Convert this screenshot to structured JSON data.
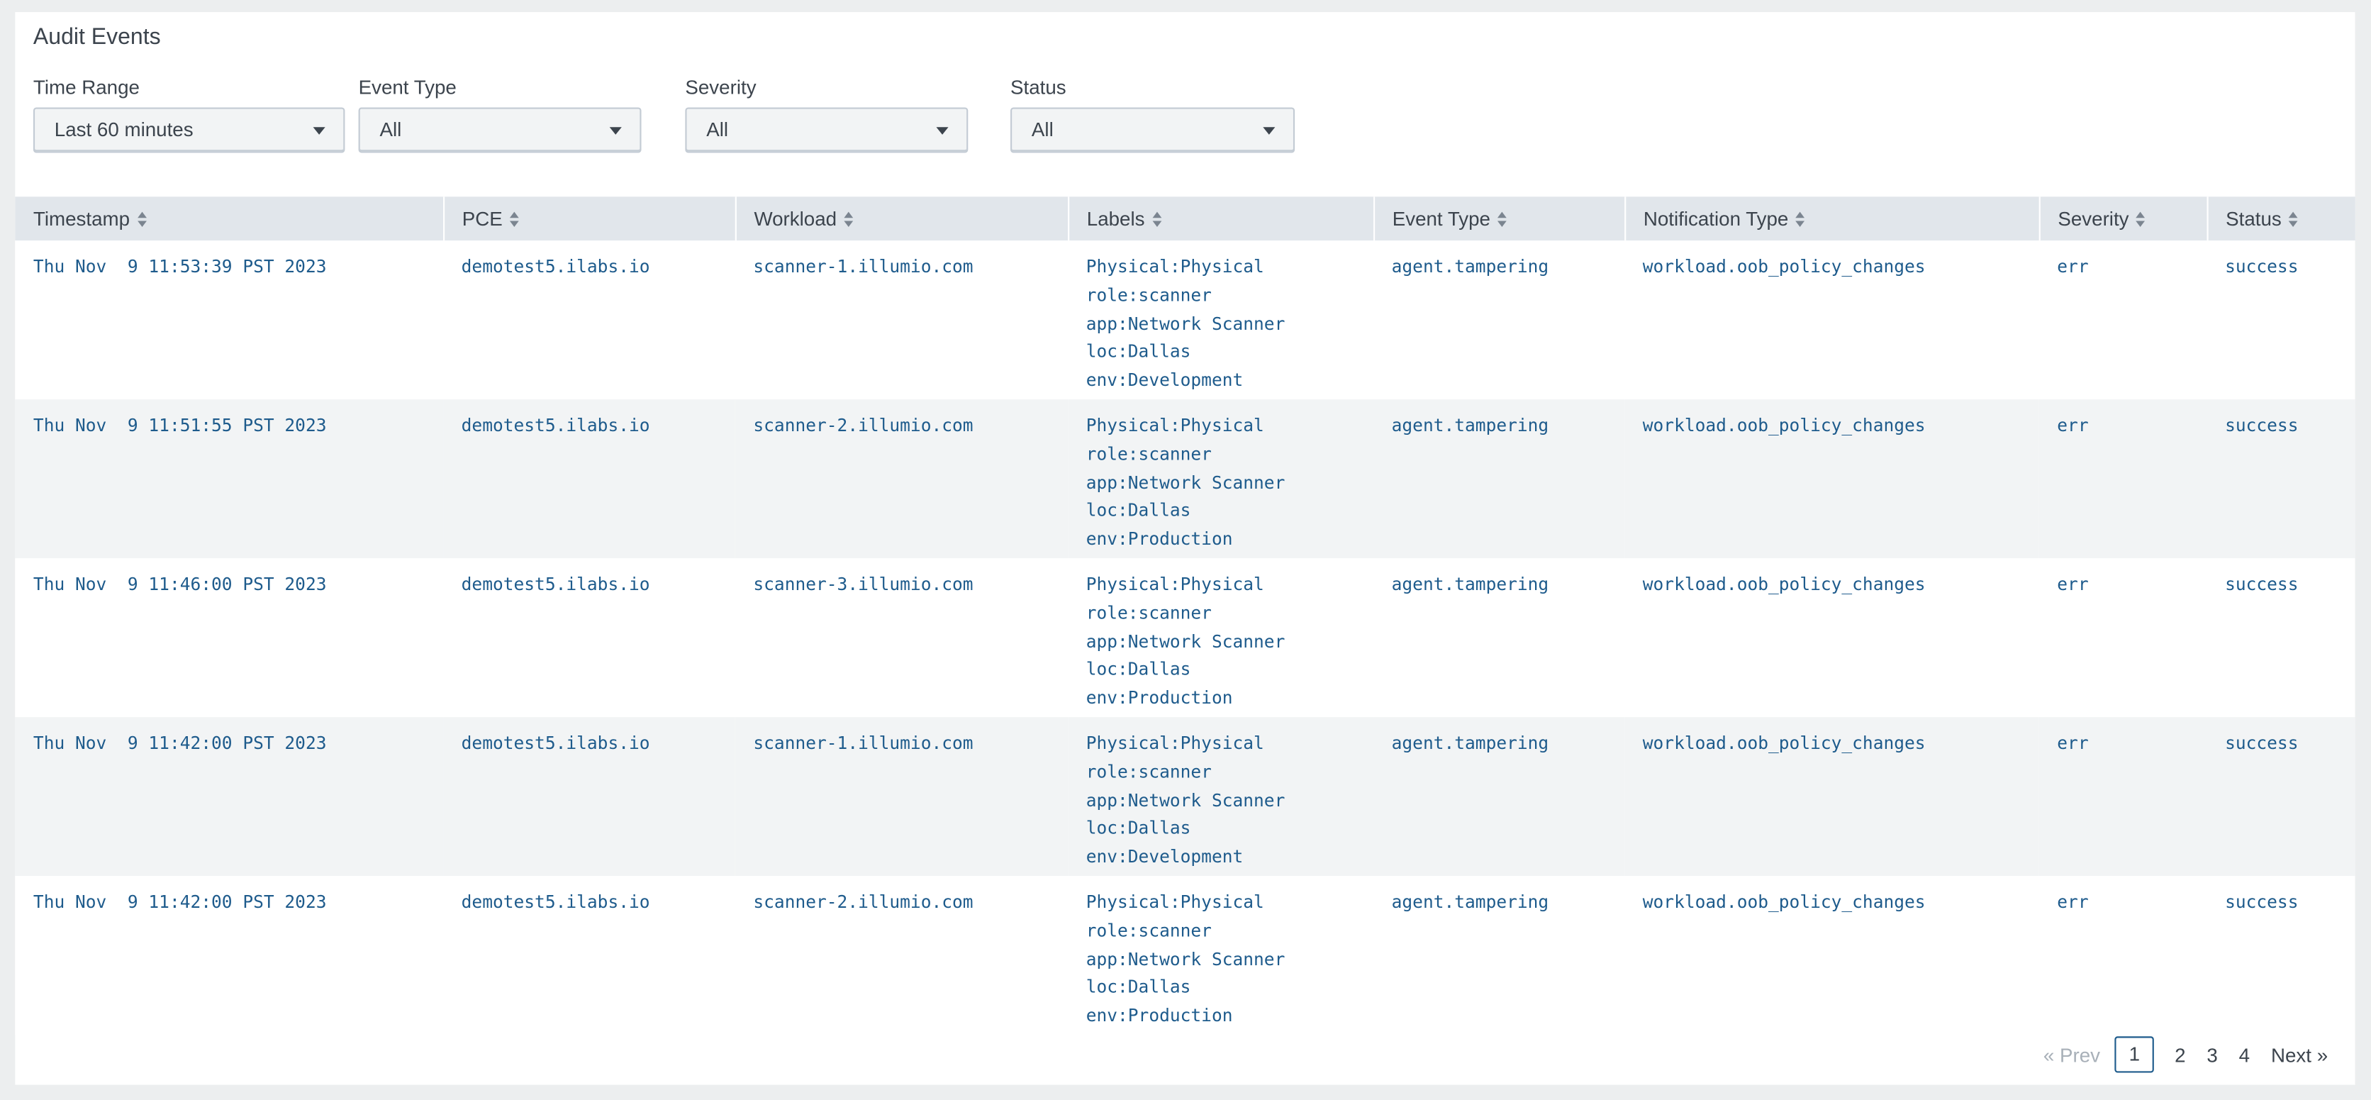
{
  "panel": {
    "title": "Audit Events"
  },
  "filters": [
    {
      "label": "Time Range",
      "value": "Last 60 minutes"
    },
    {
      "label": "Event Type",
      "value": "All"
    },
    {
      "label": "Severity",
      "value": "All"
    },
    {
      "label": "Status",
      "value": "All"
    }
  ],
  "table": {
    "columns": [
      "Timestamp",
      "PCE",
      "Workload",
      "Labels",
      "Event Type",
      "Notification Type",
      "Severity",
      "Status"
    ],
    "rows": [
      {
        "timestamp": "Thu Nov  9 11:53:39 PST 2023",
        "pce": "demotest5.ilabs.io",
        "workload": "scanner-1.illumio.com",
        "labels": [
          "Physical:Physical",
          "role:scanner",
          "app:Network Scanner",
          "loc:Dallas",
          "env:Development"
        ],
        "event_type": "agent.tampering",
        "notification_type": "workload.oob_policy_changes",
        "severity": "err",
        "status": "success"
      },
      {
        "timestamp": "Thu Nov  9 11:51:55 PST 2023",
        "pce": "demotest5.ilabs.io",
        "workload": "scanner-2.illumio.com",
        "labels": [
          "Physical:Physical",
          "role:scanner",
          "app:Network Scanner",
          "loc:Dallas",
          "env:Production"
        ],
        "event_type": "agent.tampering",
        "notification_type": "workload.oob_policy_changes",
        "severity": "err",
        "status": "success"
      },
      {
        "timestamp": "Thu Nov  9 11:46:00 PST 2023",
        "pce": "demotest5.ilabs.io",
        "workload": "scanner-3.illumio.com",
        "labels": [
          "Physical:Physical",
          "role:scanner",
          "app:Network Scanner",
          "loc:Dallas",
          "env:Production"
        ],
        "event_type": "agent.tampering",
        "notification_type": "workload.oob_policy_changes",
        "severity": "err",
        "status": "success"
      },
      {
        "timestamp": "Thu Nov  9 11:42:00 PST 2023",
        "pce": "demotest5.ilabs.io",
        "workload": "scanner-1.illumio.com",
        "labels": [
          "Physical:Physical",
          "role:scanner",
          "app:Network Scanner",
          "loc:Dallas",
          "env:Development"
        ],
        "event_type": "agent.tampering",
        "notification_type": "workload.oob_policy_changes",
        "severity": "err",
        "status": "success"
      },
      {
        "timestamp": "Thu Nov  9 11:42:00 PST 2023",
        "pce": "demotest5.ilabs.io",
        "workload": "scanner-2.illumio.com",
        "labels": [
          "Physical:Physical",
          "role:scanner",
          "app:Network Scanner",
          "loc:Dallas",
          "env:Production"
        ],
        "event_type": "agent.tampering",
        "notification_type": "workload.oob_policy_changes",
        "severity": "err",
        "status": "success"
      }
    ]
  },
  "pagination": {
    "prev_label": "« Prev",
    "pages": [
      "1",
      "2",
      "3",
      "4"
    ],
    "current_page": "1",
    "next_label": "Next »"
  }
}
